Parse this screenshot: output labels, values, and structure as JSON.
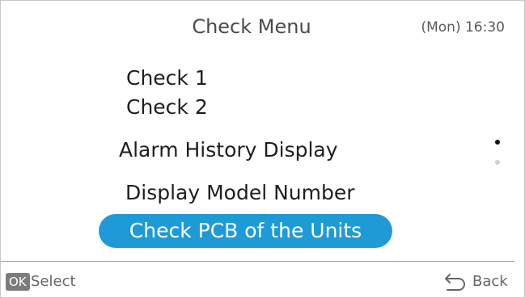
{
  "header": {
    "title": "Check Menu",
    "clock": "(Mon) 16:30"
  },
  "menu": {
    "items": [
      {
        "label": "Check 1"
      },
      {
        "label": "Check 2"
      },
      {
        "label": "Alarm History Display"
      },
      {
        "label": "Display Model Number"
      },
      {
        "label": "Check PCB of the Units",
        "selected": true
      }
    ],
    "page_count": 2,
    "current_page": 1
  },
  "footer": {
    "ok_key": "OK",
    "select_label": "Select",
    "back_icon": "back-arrow-icon",
    "back_label": "Back"
  },
  "colors": {
    "highlight": "#1e9bd7",
    "text": "#1e1e1e",
    "muted": "#666666"
  }
}
